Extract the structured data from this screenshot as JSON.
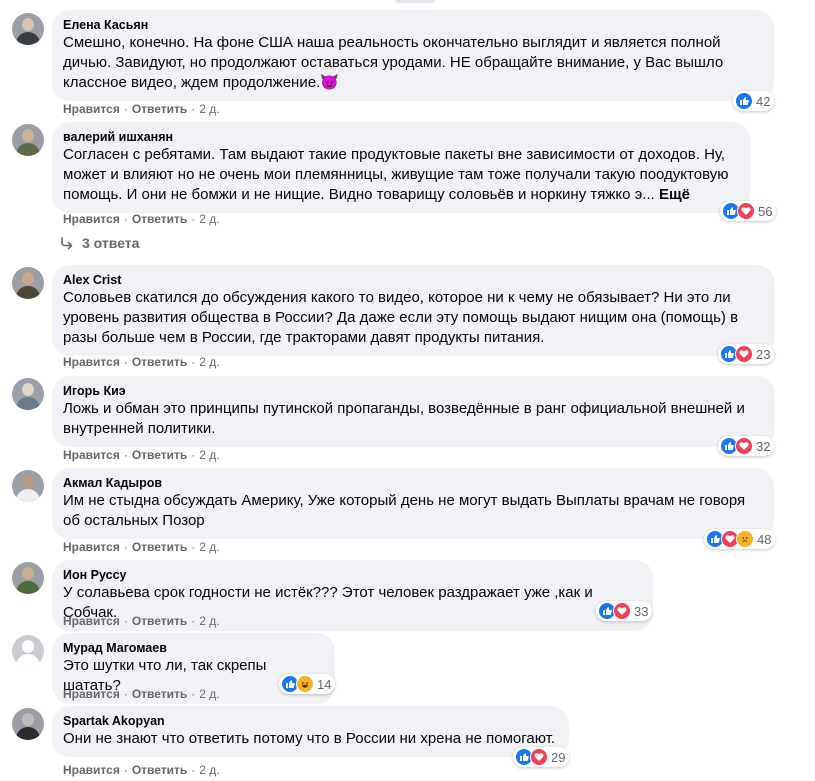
{
  "actions": {
    "like": "Нравится",
    "reply": "Ответить",
    "separator": "·"
  },
  "comments": [
    {
      "name": "Елена Касьян",
      "text": "Смешно, конечно. На фоне США наша реальность окончательно выглядит и является полной дичью. Завидуют, но продолжают оставаться уродами. НЕ обращайте внимание, у Вас вышло классное видео, ждем продолжение.",
      "emoji": "😈",
      "time": "2 д.",
      "reactions": [
        "like-icon"
      ],
      "count": "42",
      "avatar_color": "#5b5f66"
    },
    {
      "name": "валерий ишханян",
      "text": "Согласен с ребятами. Там выдают такие продуктовые пакеты вне зависимости от доходов. Ну, может и влияют но не очень мои племянницы, живущие там тоже получали такую поодуктовую помощь. И они не бомжи и не нищие. Видно товарищу соловьёв и норкину тяжко э...",
      "more": "Ещё",
      "time": "2 д.",
      "reactions": [
        "like-icon",
        "love-icon"
      ],
      "count": "56",
      "avatar_color": "#7d8c6a"
    },
    {
      "name": "Alex Crist",
      "text": "Соловьев скатился до обсуждения какого то видео, которое ни к чему не обязывает? Ни это ли уровень развития общества в России? Да даже если эту помощь выдают нищим она (помощь) в разы больше чем в России, где тракторами давят продукты питания.",
      "time": "2 д.",
      "reactions": [
        "like-icon",
        "love-icon"
      ],
      "count": "23",
      "avatar_color": "#6f6353"
    },
    {
      "name": "Игорь Киэ",
      "text": "Ложь и обман это принципы путинской пропаганды, возведённые в ранг официальной внешней и внутренней политики.",
      "time": "2 д.",
      "reactions": [
        "like-icon",
        "love-icon"
      ],
      "count": "32",
      "avatar_color": "#8e9ba3"
    },
    {
      "name": "Акмал Кадыров",
      "text": "Им не стыдна обсуждать Америку, Уже который день не могут выдать Выплаты врачам не говоря об остальных Позор",
      "time": "2 д.",
      "reactions": [
        "like-icon",
        "love-icon",
        "sad-icon"
      ],
      "count": "48",
      "avatar_color": "#9c8a7a"
    },
    {
      "name": "Ион Руссу",
      "text": "У солавьева срок годности не истёк??? Этот человек раздражает уже ,как и Собчак.",
      "time": "2 д.",
      "reactions": [
        "like-icon",
        "love-icon"
      ],
      "count": "33",
      "avatar_color": "#6b8a5a"
    },
    {
      "name": "Мурад Магомаев",
      "text": "Это шутки что ли, так скрепы шатать?",
      "time": "2 д.",
      "reactions": [
        "like-icon",
        "haha-icon"
      ],
      "count": "14",
      "avatar_color": "#c9ccd1"
    },
    {
      "name": "Spartak Akopyan",
      "text": "Они не знают что ответить потому что в России ни хрена не помогают.",
      "time": "2 д.",
      "reactions": [
        "like-icon",
        "love-icon"
      ],
      "count": "29",
      "avatar_color": "#4a4d52"
    }
  ],
  "replies_toggle": "3 ответа"
}
